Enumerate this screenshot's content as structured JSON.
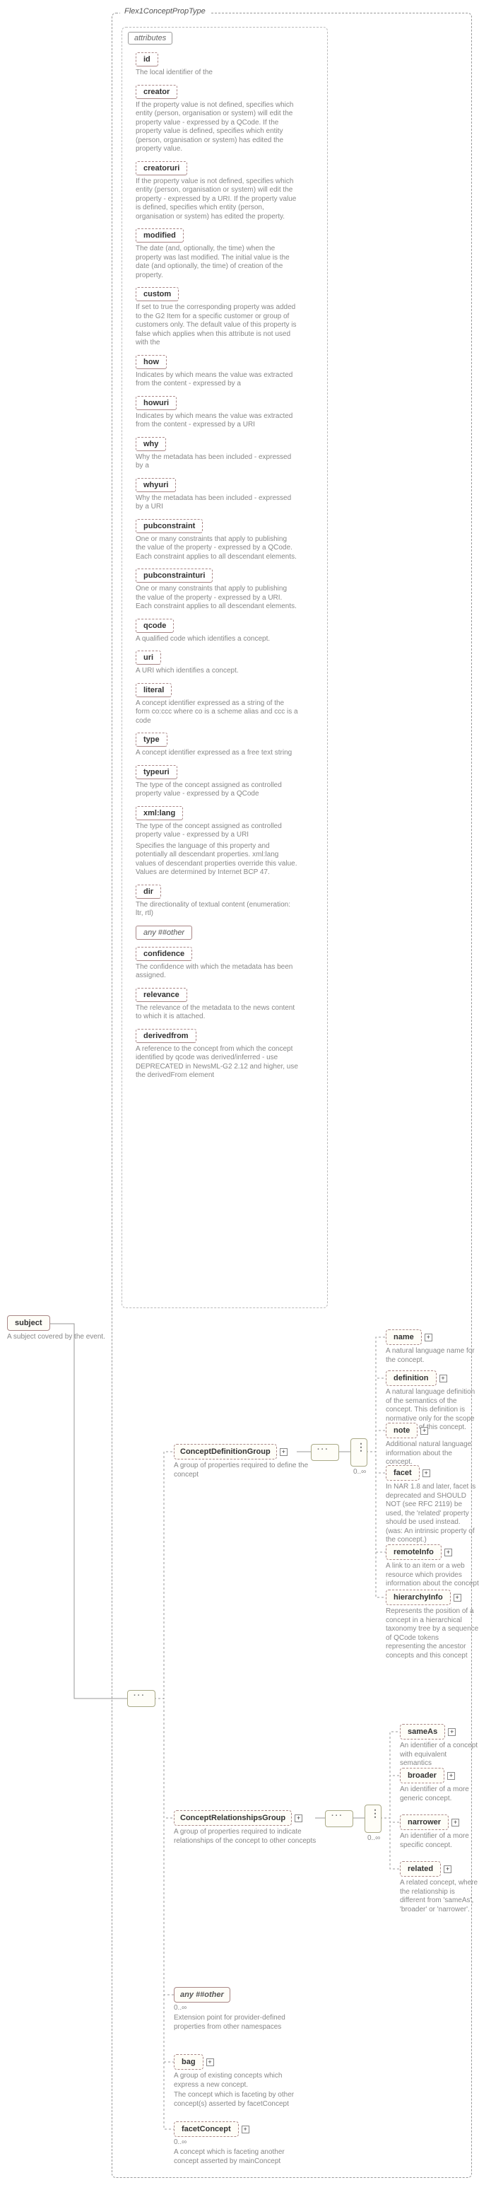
{
  "type_name": "Flex1ConceptPropType",
  "attributes_title": "attributes",
  "subject": {
    "label": "subject",
    "desc": "A subject covered by the event."
  },
  "attrs": [
    {
      "name": "id",
      "desc": "The local identifier of the"
    },
    {
      "name": "creator",
      "desc": "If the property value is not defined, specifies which entity (person, organisation or system) will edit the property value - expressed by a QCode. If the property value is defined, specifies which entity (person, organisation or system) has edited the property value."
    },
    {
      "name": "creatoruri",
      "desc": "If the property value is not defined, specifies which entity (person, organisation or system) will edit the property - expressed by a URI. If the property value is defined, specifies which entity (person, organisation or system) has edited the property."
    },
    {
      "name": "modified",
      "desc": "The date (and, optionally, the time) when the property was last modified. The initial value is the date (and optionally, the time) of creation of the property."
    },
    {
      "name": "custom",
      "desc": "If set to true the corresponding property was added to the G2 Item for a specific customer or group of customers only. The default value of this property is false which applies when this attribute is not used with the"
    },
    {
      "name": "how",
      "desc": "Indicates by which means the value was extracted from the content - expressed by a"
    },
    {
      "name": "howuri",
      "desc": "Indicates by which means the value was extracted from the content - expressed by a URI"
    },
    {
      "name": "why",
      "desc": "Why the metadata has been included - expressed by a"
    },
    {
      "name": "whyuri",
      "desc": "Why the metadata has been included - expressed by a URI"
    },
    {
      "name": "pubconstraint",
      "desc": "One or many constraints that apply to publishing the value of the property - expressed by a QCode. Each constraint applies to all descendant elements."
    },
    {
      "name": "pubconstrainturi",
      "desc": "One or many constraints that apply to publishing the value of the property - expressed by a URI. Each constraint applies to all descendant elements."
    },
    {
      "name": "qcode",
      "desc": "A qualified code which identifies a concept."
    },
    {
      "name": "uri",
      "desc": "A URI which identifies a concept."
    },
    {
      "name": "literal",
      "desc": "A concept identifier expressed as a string of the form co:ccc where co is a scheme alias and ccc is a code"
    },
    {
      "name": "type",
      "desc": "A concept identifier expressed as a free text string"
    },
    {
      "name": "typeuri",
      "desc": "The type of the concept assigned as controlled property value - expressed by a QCode"
    },
    {
      "name": "xml:lang",
      "desc": "The type of the concept assigned as controlled property value - expressed by a URI",
      "post": "Specifies the language of this property and potentially all descendant properties. xml:lang values of descendant properties override this value. Values are determined by Internet BCP 47."
    },
    {
      "name": "dir",
      "desc": "The directionality of textual content (enumeration: ltr, rtl)"
    },
    {
      "name": "any ##other",
      "wild": true
    },
    {
      "name": "confidence",
      "desc": "The confidence with which the metadata has been assigned."
    },
    {
      "name": "relevance",
      "desc": "The relevance of the metadata to the news content to which it is attached."
    },
    {
      "name": "derivedfrom",
      "desc": "A reference to the concept from which the concept identified by qcode was derived/inferred - use DEPRECATED in NewsML-G2 2.12 and higher, use the derivedFrom element"
    }
  ],
  "groups": {
    "def": {
      "label": "ConceptDefinitionGroup",
      "desc": "A group of properties required to define the concept",
      "range": "0..∞"
    },
    "rel": {
      "label": "ConceptRelationshipsGroup",
      "desc": "A group of properties required to indicate relationships of the concept to other concepts",
      "range": "0..∞"
    }
  },
  "def_children": [
    {
      "k": "name",
      "label": "name",
      "desc": "A natural language name for the concept."
    },
    {
      "k": "definition",
      "label": "definition",
      "desc": "A natural language definition of the semantics of the concept. This definition is normative only for the scope of the use of this concept."
    },
    {
      "k": "note",
      "label": "note",
      "desc": "Additional natural language information about the concept."
    },
    {
      "k": "facet",
      "label": "facet",
      "desc": "In NAR 1.8 and later, facet is deprecated and SHOULD NOT (see RFC 2119) be used, the 'related' property should be used instead. (was: An intrinsic property of the concept.)"
    },
    {
      "k": "remoteInfo",
      "label": "remoteInfo",
      "desc": "A link to an item or a web resource which provides information about the concept"
    },
    {
      "k": "hierarchyInfo",
      "label": "hierarchyInfo",
      "desc": "Represents the position of a concept in a hierarchical taxonomy tree by a sequence of QCode tokens representing the ancestor concepts and this concept"
    }
  ],
  "rel_children": [
    {
      "k": "sameAs",
      "label": "sameAs",
      "desc": "An identifier of a concept with equivalent semantics"
    },
    {
      "k": "broader",
      "label": "broader",
      "desc": "An identifier of a more generic concept."
    },
    {
      "k": "narrower",
      "label": "narrower",
      "desc": "An identifier of a more specific concept."
    },
    {
      "k": "related",
      "label": "related",
      "desc": "A related concept, where the relationship is different from 'sameAs', 'broader' or 'narrower'."
    }
  ],
  "tail": {
    "any": {
      "label": "any ##other",
      "desc": "Extension point for provider-defined properties from other namespaces",
      "range": "0..∞"
    },
    "bag": {
      "label": "bag",
      "desc": "A group of existing concepts which express a new concept.",
      "note": "The concept which is faceting by other concept(s) asserted by facetConcept"
    },
    "facetConcept": {
      "label": "facetConcept",
      "desc": "A concept which is faceting another concept asserted by mainConcept",
      "range": "0..∞"
    }
  },
  "chart_data": null
}
